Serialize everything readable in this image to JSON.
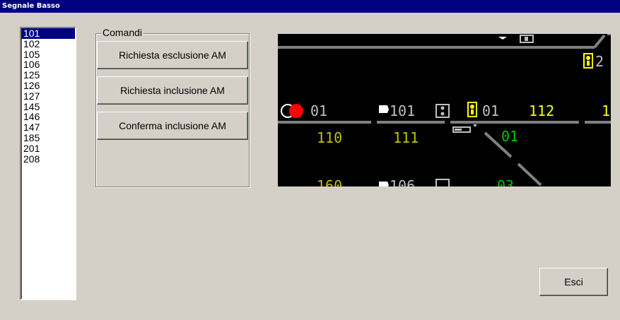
{
  "window": {
    "title": "Segnale Basso"
  },
  "signal_list": {
    "items": [
      "101",
      "102",
      "105",
      "106",
      "125",
      "126",
      "127",
      "145",
      "146",
      "147",
      "185",
      "201",
      "208"
    ],
    "selected": "101"
  },
  "commands": {
    "group_label": "Comandi",
    "buttons": {
      "request_exclusion": "Richiesta esclusione AM",
      "request_inclusion": "Richiesta inclusione AM",
      "confirm_inclusion": "Conferma inclusione AM"
    }
  },
  "exit_button": "Esci",
  "track_panel": {
    "labels": {
      "sig_01_left": "01",
      "sig_101": "101",
      "sig_01_mid": "01",
      "track_112": "112",
      "track_1_right": "1",
      "sig_2_right": "2",
      "track_110": "110",
      "track_111": "111",
      "track_01_green": "01",
      "track_160": "160",
      "sig_106": "106",
      "track_03_green": "03"
    },
    "colors": {
      "background": "#000000",
      "track": "#808080",
      "label_white": "#c0c0c0",
      "label_yellow": "#ffff00",
      "label_green": "#00c000",
      "signal_red": "#ff0000",
      "signal_yellow": "#ffff00"
    }
  }
}
